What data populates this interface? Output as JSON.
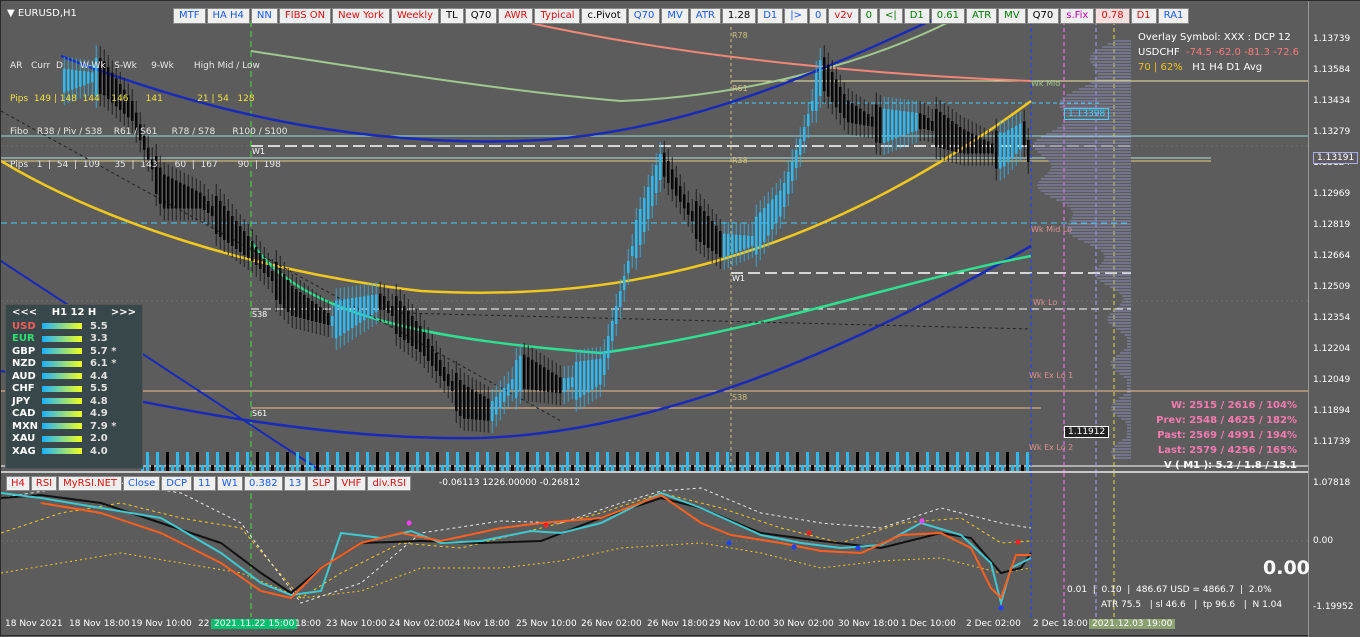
{
  "window": {
    "title": "EURUSD,H1"
  },
  "toolbar": [
    "MTF",
    "HA H4",
    "NN",
    "FIBS ON",
    "New York",
    "Weekly",
    "TL",
    "Q70",
    "AWR",
    "Typical",
    "c.Pivot",
    "Q70",
    "MV",
    "ATR",
    "1.28",
    "D1",
    "|>",
    "0",
    "v2v",
    "0",
    "<|",
    "D1",
    "0.61",
    "ATR",
    "MV",
    "Q70",
    "s.Fix",
    "0.78",
    "D1",
    "RA1"
  ],
  "info_rows": [
    "AR   Curr  D      W-Wk   S-Wk     9-Wk       High Mid / Low",
    "Pips  149 | 148  144    146      141            21 | 54   128",
    "Fibo   R38 / Piv / S38    R61 / S61     R78 / S78      R100 / S100",
    "Pips   1  |  54  |  109     35  |  143      60  |  167       90  |  198"
  ],
  "currency_panel": {
    "header_left": "<<<",
    "header_mid": "H1  12  H",
    "header_right": ">>>",
    "rows": [
      {
        "cur": "USD",
        "val": "5.5",
        "color": "#ff5a5a"
      },
      {
        "cur": "EUR",
        "val": "3.3",
        "color": "#30e070"
      },
      {
        "cur": "GBP",
        "val": "5.7 *",
        "color": "#fff"
      },
      {
        "cur": "NZD",
        "val": "6.1 *",
        "color": "#fff"
      },
      {
        "cur": "AUD",
        "val": "4.4",
        "color": "#fff"
      },
      {
        "cur": "CHF",
        "val": "5.5",
        "color": "#fff"
      },
      {
        "cur": "JPY",
        "val": "4.8",
        "color": "#fff"
      },
      {
        "cur": "CAD",
        "val": "4.9",
        "color": "#fff"
      },
      {
        "cur": "MXN",
        "val": "7.9 *",
        "color": "#fff"
      },
      {
        "cur": "XAU",
        "val": "2.0",
        "color": "#fff"
      },
      {
        "cur": "XAG",
        "val": "4.0",
        "color": "#fff"
      }
    ]
  },
  "overlay": {
    "line1": "Overlay Symbol: XXX : DCP 12",
    "line2_sym": "USDCHF",
    "line2_vals": "-74.5  -62.0  -81.3  -72.6",
    "line3_pct": "70 | 62%",
    "line3_tfs": "H1     H4     D1    Avg"
  },
  "price_axis": [
    "1.13739",
    "1.13584",
    "1.13434",
    "1.13279",
    "1.13124",
    "1.12969",
    "1.12819",
    "1.12664",
    "1.12509",
    "1.12354",
    "1.12204",
    "1.12049",
    "1.11894",
    "1.11739"
  ],
  "price_boxes": {
    "current": "1.13191",
    "mark1": "1.13398",
    "mark2": "1.11912"
  },
  "level_labels": [
    "R78",
    "R61",
    "W1",
    "R38",
    "W1",
    "S38",
    "S61",
    "S38",
    "Wk Mid Lo",
    "Wk Lo",
    "Wk Ex Lo 1",
    "Wk Ex Lo 2",
    "Wk Mid"
  ],
  "stats": {
    "w": "W: 2515 / 2616 / 104%",
    "prev": "Prev: 2548 / 4625 / 182%",
    "past": "Past: 2569 / 4991 / 194%",
    "last": "Last: 2579 / 4256 / 165%",
    "v": "V ( M1 ): 5.2 / 1.8 / 15.1"
  },
  "sub_toolbar": [
    "H4",
    "RSI",
    "MyRSI.NET",
    "Close",
    "DCP",
    "11",
    "W1",
    "0.382",
    "13",
    "SLP",
    "VHF",
    "div.RSI"
  ],
  "sub_info": "-0.06113  1226.00000  -0.26812",
  "sub_axis": [
    "1.07818",
    "0.00",
    "-1.19952"
  ],
  "big_value": "0.00",
  "bottom_info": {
    "l1": "0.01  |  0.10  |  486.67 USD = 4866.7  |  2.0%",
    "l2": "ATR 75.5   | sl 46.6   |  tp 96.6   |  N 1.04"
  },
  "time_axis": [
    "18 Nov 2021",
    "18 Nov 18:00",
    "19 Nov 10:00",
    "22",
    "2021.11.22 15:00",
    "18:00",
    "23 Nov 10:00",
    "24 Nov 02:00",
    "24 Nov 18:00",
    "25 Nov 10:00",
    "26 Nov 02:00",
    "26 Nov 18:00",
    "29 Nov 10:00",
    "30 Nov 02:00",
    "30 Nov 18:00",
    "1 Dec 10:00",
    "2 Dec 02:00",
    "2 Dec 18:00",
    "2021.12.03 19:00"
  ]
}
